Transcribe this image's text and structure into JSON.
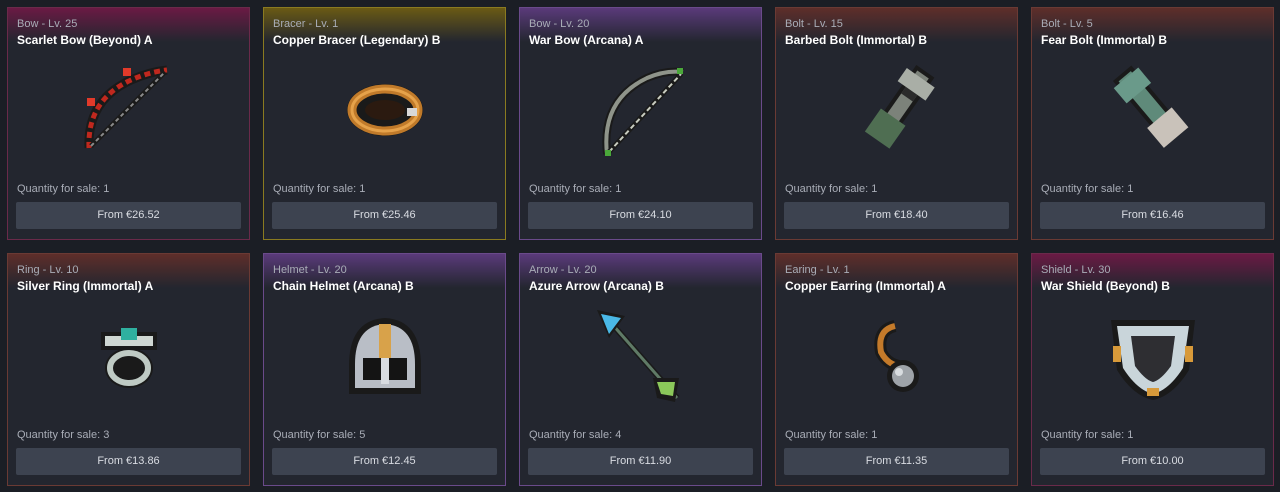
{
  "listings": [
    {
      "category": "Bow - Lv. 25",
      "name": "Scarlet Bow (Beyond) A",
      "quantity": "Quantity for sale: 1",
      "price": "From €26.52",
      "icon": "scarlet-bow-icon",
      "border": "#6a2a4a",
      "glow": "#6a1a44"
    },
    {
      "category": "Bracer - Lv. 1",
      "name": "Copper Bracer (Legendary) B",
      "quantity": "Quantity for sale: 1",
      "price": "From €25.46",
      "icon": "copper-bracer-icon",
      "border": "#8a7a20",
      "glow": "#6a5a14"
    },
    {
      "category": "Bow - Lv. 20",
      "name": "War Bow (Arcana) A",
      "quantity": "Quantity for sale: 1",
      "price": "From €24.10",
      "icon": "war-bow-icon",
      "border": "#6a4a8a",
      "glow": "#5a3a7a"
    },
    {
      "category": "Bolt - Lv. 15",
      "name": "Barbed Bolt (Immortal) B",
      "quantity": "Quantity for sale: 1",
      "price": "From €18.40",
      "icon": "barbed-bolt-icon",
      "border": "#6a3a34",
      "glow": "#5e2e2a"
    },
    {
      "category": "Bolt - Lv. 5",
      "name": "Fear Bolt (Immortal) B",
      "quantity": "Quantity for sale: 1",
      "price": "From €16.46",
      "icon": "fear-bolt-icon",
      "border": "#6a3a34",
      "glow": "#5e2e2a"
    },
    {
      "category": "Ring - Lv. 10",
      "name": "Silver Ring (Immortal) A",
      "quantity": "Quantity for sale: 3",
      "price": "From €13.86",
      "icon": "silver-ring-icon",
      "border": "#6a3a34",
      "glow": "#5e2e2a"
    },
    {
      "category": "Helmet - Lv. 20",
      "name": "Chain Helmet (Arcana) B",
      "quantity": "Quantity for sale: 5",
      "price": "From €12.45",
      "icon": "chain-helmet-icon",
      "border": "#6a4a8a",
      "glow": "#5a3a7a"
    },
    {
      "category": "Arrow - Lv. 20",
      "name": "Azure Arrow (Arcana) B",
      "quantity": "Quantity for sale: 4",
      "price": "From €11.90",
      "icon": "azure-arrow-icon",
      "border": "#6a4a8a",
      "glow": "#5a3a7a"
    },
    {
      "category": "Earing - Lv. 1",
      "name": "Copper Earring (Immortal) A",
      "quantity": "Quantity for sale: 1",
      "price": "From €11.35",
      "icon": "copper-earring-icon",
      "border": "#6a3a34",
      "glow": "#5e2e2a"
    },
    {
      "category": "Shield - Lv. 30",
      "name": "War Shield (Beyond) B",
      "quantity": "Quantity for sale: 1",
      "price": "From €10.00",
      "icon": "war-shield-icon",
      "border": "#6a2a4a",
      "glow": "#6a1a44"
    }
  ]
}
